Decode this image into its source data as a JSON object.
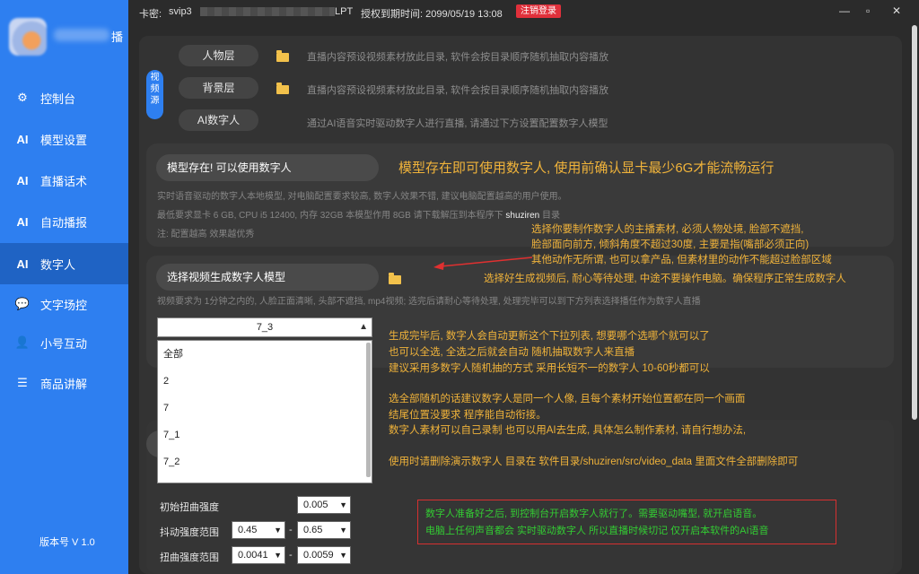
{
  "sidebar": {
    "app_name": "播",
    "items": [
      {
        "icon": "⚙",
        "label": "控制台"
      },
      {
        "icon": "AI",
        "label": "模型设置"
      },
      {
        "icon": "AI",
        "label": "直播话术"
      },
      {
        "icon": "AI",
        "label": "自动播报"
      },
      {
        "icon": "AI",
        "label": "数字人"
      },
      {
        "icon": "💬",
        "label": "文字场控"
      },
      {
        "icon": "👤",
        "label": "小号互动"
      },
      {
        "icon": "☰",
        "label": "商品讲解"
      }
    ],
    "version": "版本号 V 1.0"
  },
  "topbar": {
    "card_label": "卡密:",
    "card_value": "svip3",
    "card_tail": "LPT",
    "expire": "授权到期时间: 2099/05/19 13:08",
    "logout": "注销登录",
    "minimize": "—",
    "maximize": "▫",
    "close": "✕"
  },
  "video_source": {
    "tag": "视频源",
    "rows": [
      {
        "label": "人物层",
        "hint": "直播内容预设视频素材放此目录, 软件会按目录顺序随机抽取内容播放"
      },
      {
        "label": "背景层",
        "hint": "直播内容预设视频素材放此目录, 软件会按目录顺序随机抽取内容播放"
      },
      {
        "label": "AI数字人",
        "hint": "通过AI语音实时驱动数字人进行直播, 请通过下方设置配置数字人模型"
      }
    ]
  },
  "model": {
    "status": "模型存在! 可以使用数字人",
    "annotation": "模型存在即可使用数字人, 使用前确认显卡最少6G才能流畅运行",
    "desc1": "实时语音驱动的数字人本地模型, 对电脑配置要求较高, 数字人效果不错, 建议电脑配置越高的用户使用。",
    "desc2_pre": "最低要求显卡 6 GB, CPU i5 12400, 内存 32GB 本模型作用 8GB 请下载解压到本程序下",
    "desc2_dir": "shuziren",
    "desc2_post": "目录",
    "desc3": "注: 配置越高 效果越优秀"
  },
  "generate": {
    "button": "选择视频生成数字人模型",
    "hint": "视频要求为 1分钟之内的, 人脸正面清晰, 头部不遮挡, mp4视频; 选完后请耐心等待处理, 处理完毕可以到下方列表选择播任作为数字人直播",
    "notes": [
      "选择你要制作数字人的主播素材, 必须人物处境, 脸部不遮挡,",
      "脸部面向前方, 倾斜角度不超过30度, 主要是指(嘴部必须正向)",
      "其他动作无所谓, 也可以拿产品, 但素材里的动作不能超过脸部区域",
      "选择好生成视频后, 耐心等待处理, 中途不要操作电脑。确保程序正常生成数字人"
    ]
  },
  "dropdown": {
    "selected": "7_3",
    "options": [
      "全部",
      "2",
      "7",
      "7_1",
      "7_2"
    ]
  },
  "notes_lower": [
    "生成完毕后, 数字人会自动更新这个下拉列表, 想要哪个选哪个就可以了",
    "也可以全选, 全选之后就会自动 随机抽取数字人来直播",
    "建议采用多数字人随机抽的方式 采用长短不一的数字人 10-60秒都可以",
    "选全部随机的话建议数字人是同一个人像, 且每个素材开始位置都在同一个画面",
    "结尾位置没要求 程序能自动衔接。",
    "数字人素材可以自己录制 也可以用AI去生成, 具体怎么制作素材, 请自行想办法,",
    "使用时请删除演示数字人 目录在 软件目录/shuziren/src/video_data 里面文件全部删除即可"
  ],
  "params": [
    {
      "label": "初始扭曲强度",
      "v1": "0.005"
    },
    {
      "label": "抖动强度范围",
      "v1": "0.45",
      "v2": "0.65"
    },
    {
      "label": "扭曲强度范围",
      "v1": "0.0041",
      "v2": "0.0059"
    }
  ],
  "range_sep": "-",
  "green_notes": [
    "数字人准备好之后, 到控制台开启数字人就行了。需要驱动嘴型, 就开启语音。",
    "电脑上任何声音都会 实时驱动数字人  所以直播时候切记 仅开启本软件的AI语音"
  ],
  "colors": {
    "sidebar": "#2e7ff0",
    "accent_orange": "#f0b33a",
    "green": "#33cc33",
    "logout": "#e0303b"
  }
}
